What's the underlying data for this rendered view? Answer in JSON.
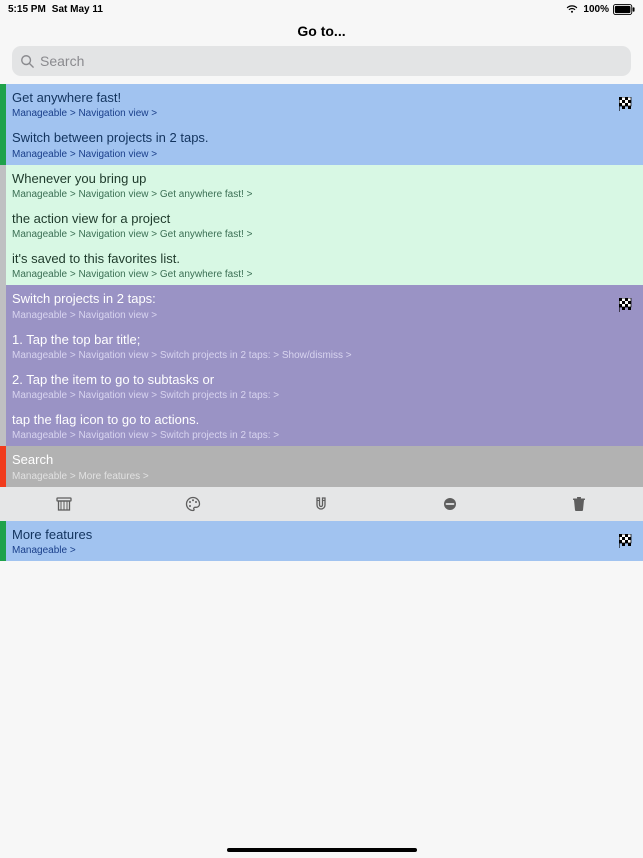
{
  "status": {
    "time": "5:15 PM",
    "date": "Sat May 11",
    "battery_pct": "100%"
  },
  "header": {
    "title": "Go to..."
  },
  "search": {
    "placeholder": "Search",
    "value": ""
  },
  "colors": {
    "blue_bg": "#a1c3f0",
    "blue_stripe": "#1fa24a",
    "blue_crumb": "#1a3f8a",
    "mint_bg": "#d8f8e4",
    "mint_stripe": "#bfc0c2",
    "mint_crumb": "#3b6f54",
    "purple_bg": "#9a93c5",
    "purple_stripe": "#bfc0c2",
    "purple_crumb": "#d8d4ef",
    "purple_title": "#ffffff",
    "grey_bg": "#b2b2b2",
    "grey_stripe": "#f13b1c",
    "grey_crumb": "#e1e1e1",
    "grey_title": "#ffffff",
    "blue2_bg": "#a1c3f0",
    "blue2_stripe": "#1fa24a",
    "blue2_crumb": "#1a3f8a"
  },
  "items": [
    {
      "title": "Get anywhere fast!",
      "crumb": "Manageable > Navigation view >",
      "bg": "blue_bg",
      "stripe": "blue_stripe",
      "title_color": "#12335d",
      "crumb_color": "blue_crumb",
      "flag": true
    },
    {
      "title": "Switch between projects in 2 taps.",
      "crumb": "Manageable > Navigation view >",
      "bg": "blue_bg",
      "stripe": "blue_stripe",
      "title_color": "#12335d",
      "crumb_color": "blue_crumb",
      "flag": false
    },
    {
      "title": "Whenever you bring up",
      "crumb": "Manageable > Navigation view > Get anywhere fast! >",
      "bg": "mint_bg",
      "stripe": "mint_stripe",
      "title_color": "#1e3a2b",
      "crumb_color": "mint_crumb",
      "flag": false
    },
    {
      "title": "the action view for a project",
      "crumb": "Manageable > Navigation view > Get anywhere fast! >",
      "bg": "mint_bg",
      "stripe": "mint_stripe",
      "title_color": "#1e3a2b",
      "crumb_color": "mint_crumb",
      "flag": false
    },
    {
      "title": "it's saved to this favorites list.",
      "crumb": "Manageable > Navigation view > Get anywhere fast! >",
      "bg": "mint_bg",
      "stripe": "mint_stripe",
      "title_color": "#1e3a2b",
      "crumb_color": "mint_crumb",
      "flag": false
    },
    {
      "title": "Switch projects in 2 taps:",
      "crumb": "Manageable > Navigation view >",
      "bg": "purple_bg",
      "stripe": "mint_stripe",
      "title_color": "#ffffff",
      "crumb_color": "purple_crumb",
      "flag": true
    },
    {
      "title": "1. Tap the top bar title;",
      "crumb": "Manageable > Navigation view > Switch projects in 2 taps: > Show/dismiss >",
      "bg": "purple_bg",
      "stripe": "mint_stripe",
      "title_color": "#ffffff",
      "crumb_color": "purple_crumb",
      "flag": false
    },
    {
      "title": "2. Tap the item to go to subtasks or",
      "crumb": "Manageable > Navigation view > Switch projects in 2 taps: >",
      "bg": "purple_bg",
      "stripe": "mint_stripe",
      "title_color": "#ffffff",
      "crumb_color": "purple_crumb",
      "flag": false
    },
    {
      "title": "tap the flag icon to go to actions.",
      "crumb": "Manageable > Navigation view > Switch projects in 2 taps: >",
      "bg": "purple_bg",
      "stripe": "mint_stripe",
      "title_color": "#ffffff",
      "crumb_color": "purple_crumb",
      "flag": false
    },
    {
      "title": "Search",
      "crumb": "Manageable > More features >",
      "bg": "grey_bg",
      "stripe": "grey_stripe",
      "title_color": "#ffffff",
      "crumb_color": "grey_crumb",
      "flag": false
    }
  ],
  "more_item": {
    "title": "More features",
    "crumb": "Manageable >",
    "bg": "blue2_bg",
    "stripe": "blue2_stripe",
    "title_color": "#12335d",
    "crumb_color": "blue2_crumb",
    "flag": true
  },
  "toolbar_icons": [
    "archive",
    "palette",
    "magnet",
    "remove",
    "trash"
  ]
}
